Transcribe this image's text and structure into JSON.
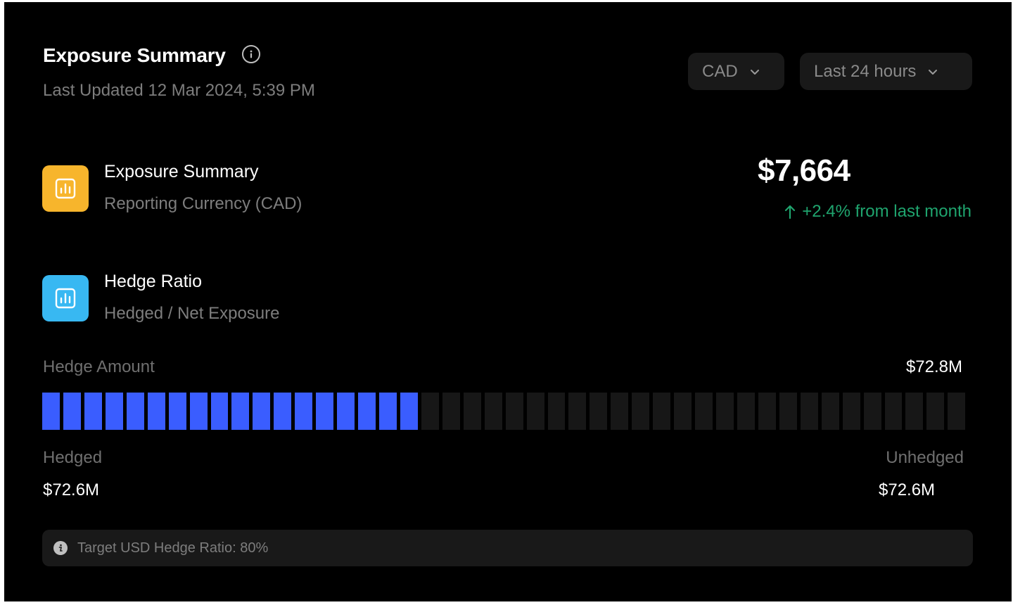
{
  "header": {
    "title": "Exposure Summary",
    "last_updated": "Last Updated 12 Mar 2024, 5:39 PM",
    "info_icon": "info-icon"
  },
  "filters": {
    "currency": {
      "value": "CAD",
      "icon": "chevron-down-icon"
    },
    "time_range": {
      "value": "Last 24 hours",
      "icon": "chevron-down-icon"
    }
  },
  "metrics": [
    {
      "title": "Exposure Summary",
      "subtitle": "Reporting Currency (CAD)",
      "icon": "bar-chart-icon",
      "icon_color": "#f7b52c"
    },
    {
      "title": "Hedge Ratio",
      "subtitle": "Hedged / Net Exposure",
      "icon": "bar-chart-icon",
      "icon_color": "#38b8f2"
    }
  ],
  "summary": {
    "value": "$7,664",
    "change": "+2.4% from last month",
    "change_icon": "arrow-up-icon",
    "change_color": "#1fa46e"
  },
  "hedge": {
    "label": "Hedge Amount",
    "total": "$72.8M",
    "bar": {
      "filled_segments": 18,
      "total_segments": 44,
      "filled_color": "#3a5dff",
      "empty_color": "#171717"
    },
    "hedged_label": "Hedged",
    "hedged_value": "$72.6M",
    "unhedged_label": "Unhedged",
    "unhedged_value": "$72.6M"
  },
  "note": {
    "icon": "info-icon",
    "text": "Target USD Hedge Ratio: 80%"
  }
}
